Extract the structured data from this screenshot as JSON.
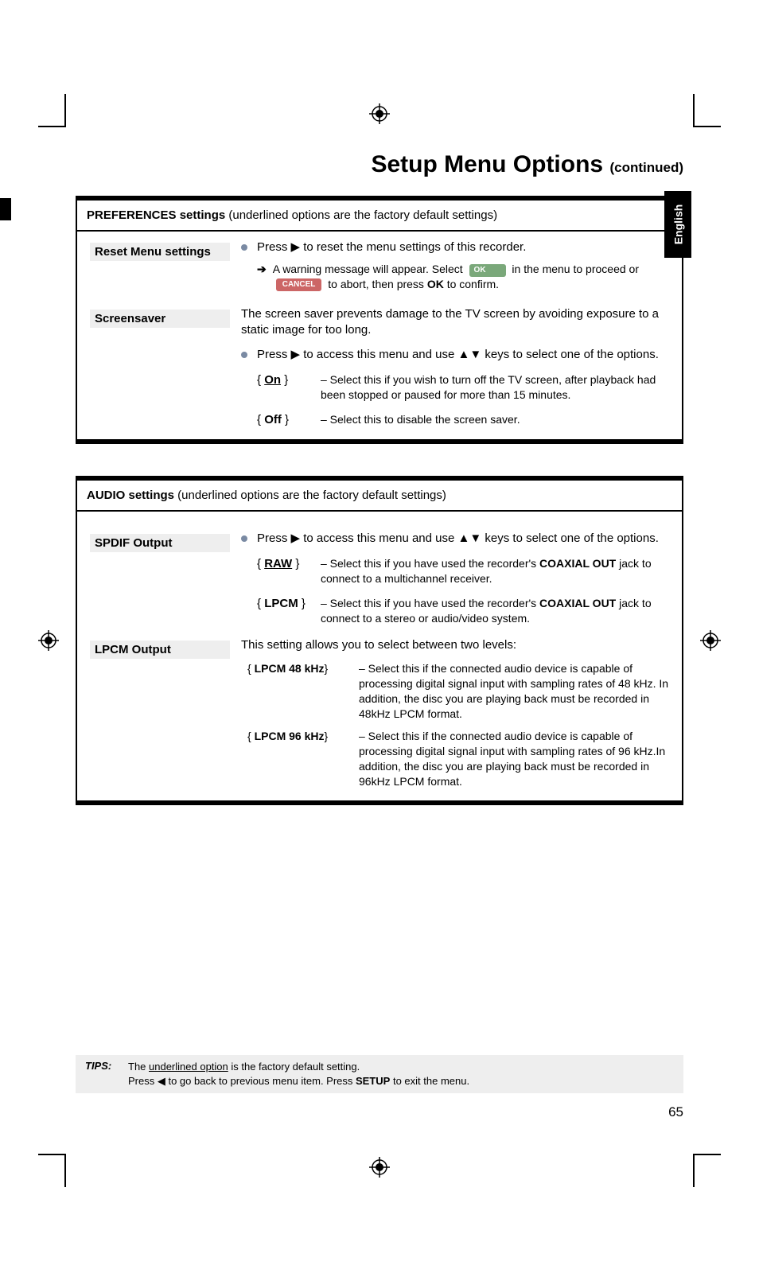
{
  "page": {
    "title_main": "Setup Menu Options",
    "title_sub": "(continued)",
    "number": "65",
    "language_tab": "English"
  },
  "prefs_box": {
    "header_bold": "PREFERENCES settings",
    "header_rest": " (underlined options are the factory default settings)",
    "reset": {
      "label": "Reset Menu settings",
      "line1_pre": "Press ",
      "line1_post": " to reset the menu settings of this recorder.",
      "arrow_glyph": "▶",
      "warn_pre": "A warning message will appear. Select ",
      "ok_label": "OK",
      "warn_mid": " in the menu to proceed or ",
      "cancel_label": "CANCEL",
      "warn_post": " to abort, then press ",
      "ok_bold": "OK",
      "warn_end": " to confirm."
    },
    "screensaver": {
      "label": "Screensaver",
      "intro": "The screen saver prevents damage to the TV screen by avoiding  exposure to a static image for too long.",
      "access_pre": "Press ",
      "access_mid": " to access this menu and use ",
      "up_glyph": "▲",
      "down_glyph": "▼",
      "access_post": " keys to select one of the options.",
      "opt_on_label": "On",
      "opt_on_desc": "– Select this if you wish to turn off the TV screen, after playback had been stopped or paused for more than 15 minutes.",
      "opt_off_label": "Off",
      "opt_off_desc": "– Select this to disable the screen saver."
    }
  },
  "audio_box": {
    "header_bold": "AUDIO settings",
    "header_rest": " (underlined options are the factory default settings)",
    "spdif": {
      "label": "SPDIF Output",
      "access_pre": "Press ",
      "arrow_glyph": "▶",
      "access_mid": " to access this menu and use ",
      "up_glyph": "▲",
      "down_glyph": "▼",
      "access_post": " keys to select one of the options.",
      "opt_raw_label": "RAW",
      "opt_raw_desc_pre": "– Select this if you have used the recorder's ",
      "coax": "COAXIAL OUT",
      "opt_raw_desc_post": " jack to connect to a multichannel receiver.",
      "opt_lpcm_label": "LPCM",
      "opt_lpcm_desc_pre": "– Select this if you have used the recorder's ",
      "opt_lpcm_desc_post": " jack to connect to a stereo or audio/video system."
    },
    "lpcm": {
      "label": "LPCM Output",
      "intro": "This setting allows you to select between two levels:",
      "opt48_label": "LPCM 48 kHz",
      "opt48_desc": "– Select this if the connected audio device is capable of processing digital signal input with sampling rates of 48 kHz. In addition, the disc you are playing back must be recorded in 48kHz LPCM format.",
      "opt96_label": "LPCM 96 kHz",
      "opt96_desc": "– Select this if the connected audio device is capable of processing digital signal input with sampling rates of 96 kHz.In addition, the disc you are playing back must be recorded in 96kHz LPCM format."
    }
  },
  "tips": {
    "label": "TIPS:",
    "line1_pre": "The ",
    "line1_ul": "underlined option",
    "line1_post": " is the factory default setting.",
    "line2_pre": "Press ",
    "left_glyph": "◀",
    "line2_mid": " to go back to previous menu item. Press ",
    "setup_bold": "SETUP",
    "line2_post": " to exit the menu."
  }
}
